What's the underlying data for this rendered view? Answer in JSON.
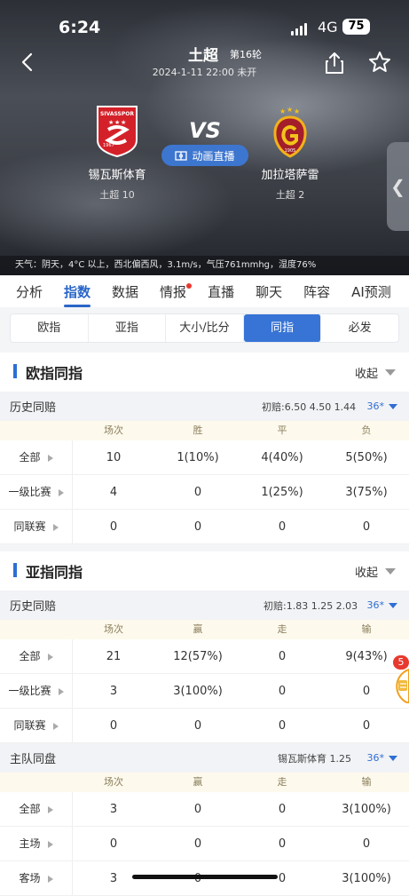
{
  "status": {
    "time": "6:24",
    "network": "4G",
    "battery": "75"
  },
  "match": {
    "league": "土超",
    "round": "第16轮",
    "datetime": "2024-1-11 22:00 未开",
    "vs": "VS",
    "animation_label": "动画直播",
    "home": {
      "name": "锡瓦斯体育",
      "rank": "土超 10",
      "badge_text": "SIVASSPOR",
      "badge_year": "1967"
    },
    "away": {
      "name": "加拉塔萨雷",
      "rank": "土超 2",
      "badge_year": "1905"
    }
  },
  "weather": "天气：阴天，4°C 以上，西北偏西风，3.1m/s，气压761mmhg，湿度76%",
  "tabs": [
    "分析",
    "指数",
    "数据",
    "情报",
    "直播",
    "聊天",
    "阵容",
    "AI预测"
  ],
  "subtabs": [
    "欧指",
    "亚指",
    "大小/比分",
    "同指",
    "必发"
  ],
  "collapse_label": "收起",
  "euro": {
    "title": "欧指同指",
    "group": "历史同赔",
    "initial": "初赔:6.50 4.50 1.44",
    "company": "36*",
    "columns": [
      "场次",
      "胜",
      "平",
      "负"
    ],
    "rows": [
      {
        "label": "全部",
        "v": [
          "10",
          "1(10%)",
          "4(40%)",
          "5(50%)"
        ]
      },
      {
        "label": "一级比赛",
        "v": [
          "4",
          "0",
          "1(25%)",
          "3(75%)"
        ]
      },
      {
        "label": "同联赛",
        "v": [
          "0",
          "0",
          "0",
          "0"
        ]
      }
    ]
  },
  "asian": {
    "title": "亚指同指",
    "group": "历史同赔",
    "initial": "初赔:1.83 1.25 2.03",
    "company": "36*",
    "columns": [
      "场次",
      "赢",
      "走",
      "输"
    ],
    "rows": [
      {
        "label": "全部",
        "v": [
          "21",
          "12(57%)",
          "0",
          "9(43%)"
        ]
      },
      {
        "label": "一级比赛",
        "v": [
          "3",
          "3(100%)",
          "0",
          "0"
        ]
      },
      {
        "label": "同联赛",
        "v": [
          "0",
          "0",
          "0",
          "0"
        ]
      }
    ],
    "home_group": "主队同盘",
    "home_initial": "锡瓦斯体育 1.25",
    "home_company": "36*",
    "home_columns": [
      "场次",
      "赢",
      "走",
      "输"
    ],
    "home_rows": [
      {
        "label": "全部",
        "v": [
          "3",
          "0",
          "0",
          "3(100%)"
        ]
      },
      {
        "label": "主场",
        "v": [
          "0",
          "0",
          "0",
          "0"
        ]
      },
      {
        "label": "客场",
        "v": [
          "3",
          "0",
          "0",
          "3(100%)"
        ]
      }
    ]
  },
  "float_badge": "5"
}
